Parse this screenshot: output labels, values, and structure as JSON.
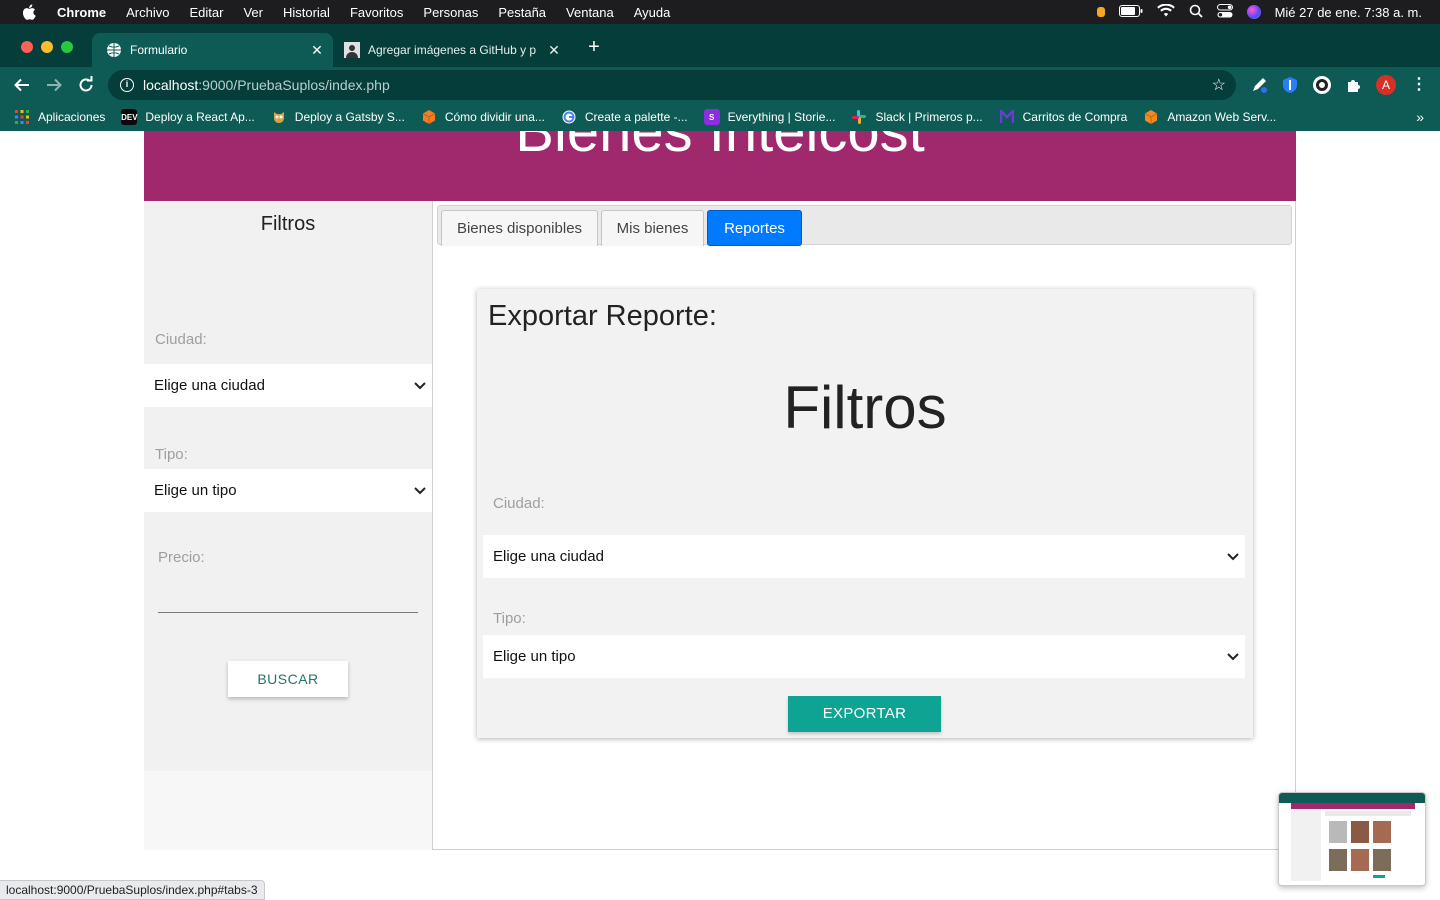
{
  "menubar": {
    "items": [
      "Chrome",
      "Archivo",
      "Editar",
      "Ver",
      "Historial",
      "Favoritos",
      "Personas",
      "Pestaña",
      "Ventana",
      "Ayuda"
    ],
    "datetime": "Mié 27 de ene.  7:38 a. m."
  },
  "browser": {
    "tabs": [
      {
        "title": "Formulario",
        "active": true
      },
      {
        "title": "Agregar imágenes a GitHub y p",
        "active": false
      }
    ],
    "url_host": "localhost",
    "url_path": ":9000/PruebaSuplos/index.php",
    "profile_initial": "A",
    "bookmarks": [
      {
        "label": "Aplicaciones",
        "icon": "apps-grid-icon",
        "color": "#e8453c"
      },
      {
        "label": "Deploy a React Ap...",
        "icon": "dev-icon",
        "color": "#0a0a0a"
      },
      {
        "label": "Deploy a Gatsby S...",
        "icon": "owl-icon",
        "color": "#d4a24a"
      },
      {
        "label": "Cómo dividir una...",
        "icon": "cube-icon",
        "color": "#f47d20"
      },
      {
        "label": "Create a palette -...",
        "icon": "google-icon",
        "color": "#4285f4"
      },
      {
        "label": "Everything | Storie...",
        "icon": "storybook-icon",
        "color": "#8c2de0"
      },
      {
        "label": "Slack | Primeros p...",
        "icon": "slack-icon",
        "color": "#2eb67d"
      },
      {
        "label": "Carritos de Compra",
        "icon": "m-icon",
        "color": "#6c3bd6"
      },
      {
        "label": "Amazon Web Serv...",
        "icon": "aws-cube-icon",
        "color": "#f48a1f"
      }
    ]
  },
  "page": {
    "banner_title": "Bienes Intelcost",
    "sidebar": {
      "title": "Filtros",
      "ciudad_label": "Ciudad:",
      "ciudad_value": "Elige una ciudad",
      "tipo_label": "Tipo:",
      "tipo_value": "Elige un tipo",
      "precio_label": "Precio:",
      "search_button": "BUSCAR"
    },
    "tabs": [
      "Bienes disponibles",
      "Mis bienes",
      "Reportes"
    ],
    "active_tab": "Reportes",
    "report": {
      "title": "Exportar Reporte:",
      "heading": "Filtros",
      "ciudad_label": "Ciudad:",
      "ciudad_value": "Elige una ciudad",
      "tipo_label": "Tipo:",
      "tipo_value": "Elige un tipo",
      "export_button": "EXPORTAR"
    }
  },
  "status_url": "localhost:9000/PruebaSuplos/index.php#tabs-3",
  "colors": {
    "banner": "#a0286c",
    "active_tab": "#007bff",
    "export_button": "#0fa394",
    "chrome_frame": "#0e5b56"
  }
}
